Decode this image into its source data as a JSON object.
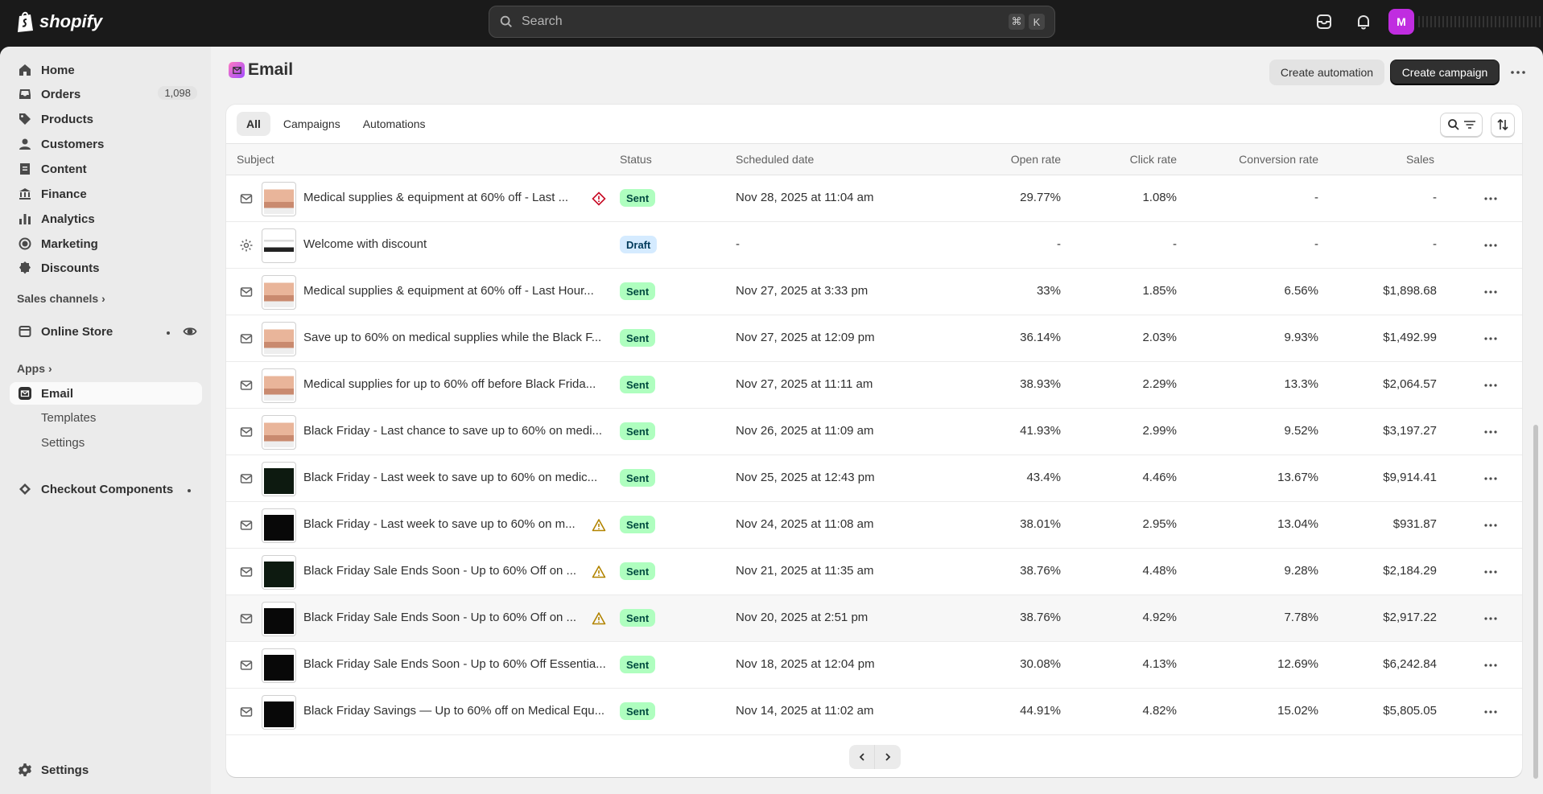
{
  "topbar": {
    "brand": "shopify",
    "search_placeholder": "Search",
    "shortcut_cmd": "⌘",
    "shortcut_key": "K",
    "avatar_initial": "M"
  },
  "sidebar": {
    "items": [
      {
        "label": "Home",
        "icon": "home-icon"
      },
      {
        "label": "Orders",
        "icon": "inbox-icon",
        "badge": "1,098"
      },
      {
        "label": "Products",
        "icon": "tag-icon"
      },
      {
        "label": "Customers",
        "icon": "person-icon"
      },
      {
        "label": "Content",
        "icon": "document-icon"
      },
      {
        "label": "Finance",
        "icon": "bank-icon"
      },
      {
        "label": "Analytics",
        "icon": "bar-chart-icon"
      },
      {
        "label": "Marketing",
        "icon": "target-icon"
      },
      {
        "label": "Discounts",
        "icon": "discount-icon"
      }
    ],
    "sales_channels_label": "Sales channels",
    "online_store_label": "Online Store",
    "apps_label": "Apps",
    "email_label": "Email",
    "email_sub": [
      "Templates",
      "Settings"
    ],
    "checkout_components_label": "Checkout Components",
    "settings_label": "Settings"
  },
  "page": {
    "title": "Email",
    "create_automation": "Create automation",
    "create_campaign": "Create campaign"
  },
  "tabs": [
    "All",
    "Campaigns",
    "Automations"
  ],
  "columns": {
    "subject": "Subject",
    "status": "Status",
    "scheduled": "Scheduled date",
    "open": "Open rate",
    "click": "Click rate",
    "conversion": "Conversion rate",
    "sales": "Sales"
  },
  "rows": [
    {
      "type": "email",
      "subject": "Medical supplies & equipment at 60% off - Last ...",
      "warn": "error",
      "status": "Sent",
      "date": "Nov 28, 2025 at 11:04 am",
      "open": "29.77%",
      "click": "1.08%",
      "conv": "-",
      "sales": "-",
      "thumb": "peach"
    },
    {
      "type": "automation",
      "subject": "Welcome with discount",
      "warn": "",
      "status": "Draft",
      "date": "-",
      "open": "-",
      "click": "-",
      "conv": "-",
      "sales": "-",
      "thumb": "white"
    },
    {
      "type": "email",
      "subject": "Medical supplies & equipment at 60% off - Last Hour...",
      "warn": "",
      "status": "Sent",
      "date": "Nov 27, 2025 at 3:33 pm",
      "open": "33%",
      "click": "1.85%",
      "conv": "6.56%",
      "sales": "$1,898.68",
      "thumb": "peach"
    },
    {
      "type": "email",
      "subject": "Save up to 60% on medical supplies while the Black F...",
      "warn": "",
      "status": "Sent",
      "date": "Nov 27, 2025 at 12:09 pm",
      "open": "36.14%",
      "click": "2.03%",
      "conv": "9.93%",
      "sales": "$1,492.99",
      "thumb": "peach"
    },
    {
      "type": "email",
      "subject": "Medical supplies for up to 60% off before Black Frida...",
      "warn": "",
      "status": "Sent",
      "date": "Nov 27, 2025 at 11:11 am",
      "open": "38.93%",
      "click": "2.29%",
      "conv": "13.3%",
      "sales": "$2,064.57",
      "thumb": "peach"
    },
    {
      "type": "email",
      "subject": "Black Friday - Last chance to save up to 60% on medi...",
      "warn": "",
      "status": "Sent",
      "date": "Nov 26, 2025 at 11:09 am",
      "open": "41.93%",
      "click": "2.99%",
      "conv": "9.52%",
      "sales": "$3,197.27",
      "thumb": "peach"
    },
    {
      "type": "email",
      "subject": "Black Friday - Last week to save up to 60% on medic...",
      "warn": "",
      "status": "Sent",
      "date": "Nov 25, 2025 at 12:43 pm",
      "open": "43.4%",
      "click": "4.46%",
      "conv": "13.67%",
      "sales": "$9,914.41",
      "thumb": "darkgreen"
    },
    {
      "type": "email",
      "subject": "Black Friday - Last week to save up to 60% on m...",
      "warn": "warning",
      "status": "Sent",
      "date": "Nov 24, 2025 at 11:08 am",
      "open": "38.01%",
      "click": "2.95%",
      "conv": "13.04%",
      "sales": "$931.87",
      "thumb": "black"
    },
    {
      "type": "email",
      "subject": "Black Friday Sale Ends Soon - Up to 60% Off on ...",
      "warn": "warning",
      "status": "Sent",
      "date": "Nov 21, 2025 at 11:35 am",
      "open": "38.76%",
      "click": "4.48%",
      "conv": "9.28%",
      "sales": "$2,184.29",
      "thumb": "darkgreen"
    },
    {
      "type": "email",
      "subject": "Black Friday Sale Ends Soon - Up to 60% Off on ...",
      "warn": "warning",
      "status": "Sent",
      "date": "Nov 20, 2025 at 2:51 pm",
      "open": "38.76%",
      "click": "4.92%",
      "conv": "7.78%",
      "sales": "$2,917.22",
      "thumb": "black"
    },
    {
      "type": "email",
      "subject": "Black Friday Sale Ends Soon - Up to 60% Off Essentia...",
      "warn": "",
      "status": "Sent",
      "date": "Nov 18, 2025 at 12:04 pm",
      "open": "30.08%",
      "click": "4.13%",
      "conv": "12.69%",
      "sales": "$6,242.84",
      "thumb": "black"
    },
    {
      "type": "email",
      "subject": "Black Friday Savings — Up to 60% off on Medical Equ...",
      "warn": "",
      "status": "Sent",
      "date": "Nov 14, 2025 at 11:02 am",
      "open": "44.91%",
      "click": "4.82%",
      "conv": "15.02%",
      "sales": "$5,805.05",
      "thumb": "black"
    }
  ],
  "colors": {
    "sent_badge": "#affebf",
    "draft_badge": "#d5ebff",
    "error_icon": "#c70a24",
    "warning_icon": "#b28400"
  }
}
